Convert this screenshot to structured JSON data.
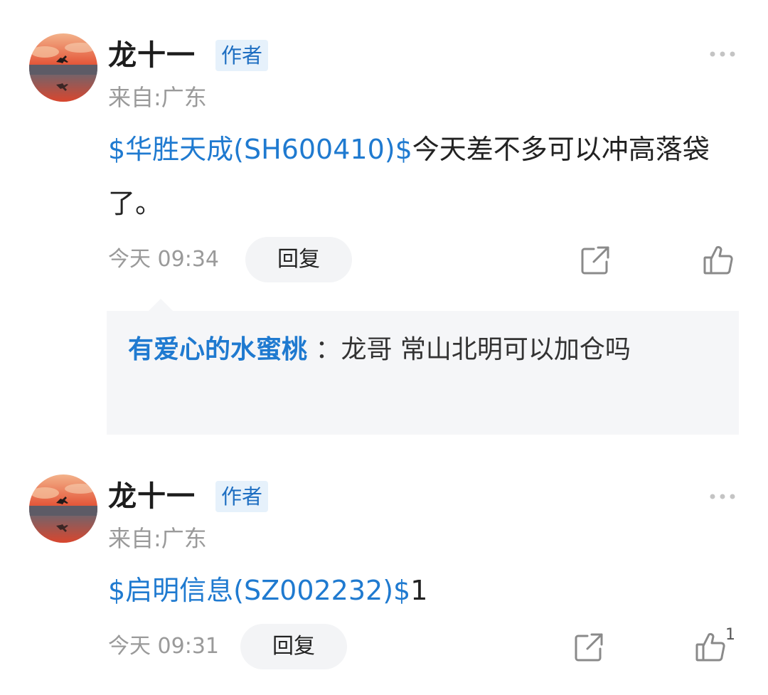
{
  "comments": [
    {
      "username": "龙十一",
      "badge": "作者",
      "location": "来自:广东",
      "stock": "$华胜天成(SH600410)$",
      "text": "今天差不多可以冲高落袋了。",
      "time": "今天 09:34",
      "reply_label": "回复",
      "reply": {
        "user": "有爱心的水蜜桃",
        "separator": " ：",
        "text": "龙哥 常山北明可以加仓吗"
      }
    },
    {
      "username": "龙十一",
      "badge": "作者",
      "location": "来自:广东",
      "stock": "$启明信息(SZ002232)$",
      "text": "1",
      "time": "今天 09:31",
      "reply_label": "回复",
      "like_count": "1"
    }
  ],
  "icons": {
    "more": "more-dots-icon",
    "share": "share-icon",
    "like": "thumbs-up-icon"
  },
  "colors": {
    "link": "#1f7ad0",
    "badge_bg": "#e6f1fb",
    "meta": "#9a9a9a"
  }
}
